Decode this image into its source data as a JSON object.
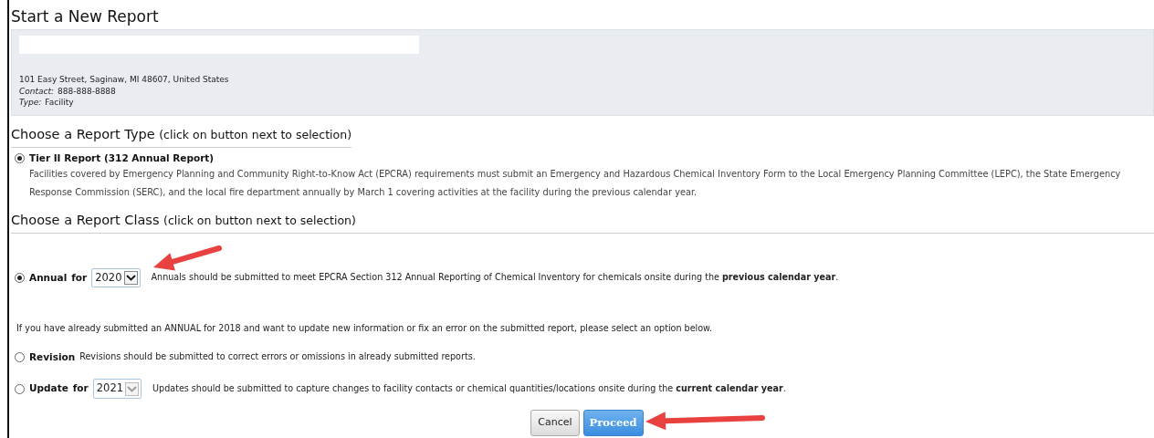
{
  "page": {
    "title": "Start a New Report"
  },
  "facility": {
    "address": "101 Easy Street, Saginaw, MI 48607, United States",
    "contact_label": "Contact:",
    "contact": "888-888-8888",
    "type_label": "Type:",
    "type": "Facility"
  },
  "report_type": {
    "heading": "Choose a Report Type",
    "hint": "(click on button next to selection)",
    "options": [
      {
        "label": "Tier II Report (312 Annual Report)",
        "selected": true,
        "description": "Facilities covered by Emergency Planning and Community Right-to-Know Act (EPCRA) requirements must submit an Emergency and Hazardous Chemical Inventory Form to the Local Emergency Planning Committee (LEPC), the State Emergency Response Commission (SERC), and the local fire department annually by March 1 covering activities at the facility during the previous calendar year."
      }
    ]
  },
  "report_class": {
    "heading": "Choose a Report Class",
    "hint": "(click on button next to selection)",
    "items": [
      {
        "kind": "year",
        "label": "Annual",
        "for": "for",
        "year": "2020",
        "year_disabled": false,
        "selected": true,
        "description": "Annuals should be submitted to meet EPCRA Section 312 Annual Reporting of Chemical Inventory for chemicals onsite during the **previous calendar year**."
      },
      {
        "kind": "note",
        "text": "If you have already submitted an ANNUAL for 2018 and want to update new information or fix an error on the submitted report, please select an option below."
      },
      {
        "kind": "plain",
        "label": "Revision",
        "selected": false,
        "description": "Revisions should be submitted to correct errors or omissions in already submitted reports."
      },
      {
        "kind": "year",
        "label": "Update",
        "for": "for",
        "year": "2021",
        "year_disabled": true,
        "selected": false,
        "description": "Updates should be submitted to capture changes to facility contacts or chemical quantities/locations onsite during the **current calendar year**."
      }
    ]
  },
  "buttons": [
    {
      "label": "Cancel",
      "kind": "secondary"
    },
    {
      "label": "Proceed",
      "kind": "primary"
    }
  ]
}
